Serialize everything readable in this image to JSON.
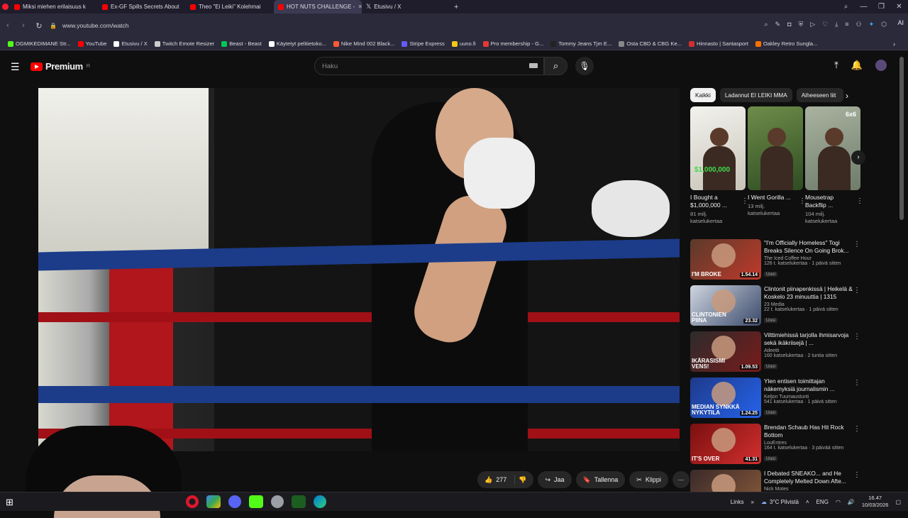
{
  "browser": {
    "tabs": [
      {
        "label": "Miksi miehen erilaisuus k",
        "color": "#ff3b30",
        "active": false
      },
      {
        "label": "Ex-GF Spills Secrets About",
        "color": "#ff0000",
        "active": false
      },
      {
        "label": "Theo \"Ei Leiki\" Kolehmai",
        "color": "#ff0000",
        "active": false
      },
      {
        "label": "HOT NUTS CHALLENGE -",
        "color": "#ff0000",
        "active": true
      },
      {
        "label": "Etusivu / X",
        "color": "#ffffff",
        "active": false
      }
    ],
    "new_tab": "+",
    "url": "www.youtube.com/watch",
    "ai_label": "AI",
    "bookmarks": [
      {
        "label": "OGMIKEDIMANE Str...",
        "color": "#53fc18"
      },
      {
        "label": "YouTube",
        "color": "#ff0000"
      },
      {
        "label": "Etusivu / X",
        "color": "#ffffff"
      },
      {
        "label": "Twitch Emote Resizer",
        "color": "#cccccc"
      },
      {
        "label": "Beast - Beast",
        "color": "#00c853"
      },
      {
        "label": "Käytetyt pelitietoko...",
        "color": "#ffffff"
      },
      {
        "label": "Nike Mind 002 Black...",
        "color": "#ff5a36"
      },
      {
        "label": "Stripe Express",
        "color": "#635bff"
      },
      {
        "label": "uuno.fi",
        "color": "#f5c518"
      },
      {
        "label": "Pro membership - G...",
        "color": "#e53935"
      },
      {
        "label": "Tommy Jeans Tjm E...",
        "color": "#222222"
      },
      {
        "label": "Osta CBD & CBG Ke...",
        "color": "#888888"
      },
      {
        "label": "Hinnasto | Santasport",
        "color": "#d32f2f"
      },
      {
        "label": "Oakley Retro Sungla...",
        "color": "#ff6f00"
      }
    ]
  },
  "youtube": {
    "brand": "Premium",
    "brand_region": "FI",
    "search_placeholder": "Haku",
    "actions": {
      "likes": "277",
      "share": "Jaa",
      "save": "Tallenna",
      "clip": "Klippi"
    },
    "chips": [
      "Kaikki",
      "Ladannut EI LEIKI MMA",
      "Aiheeseen liit"
    ],
    "shorts": [
      {
        "title": "I Bought a $1,000,000 ...",
        "views": "81 milj. katselukertaa",
        "badge": "$1,000,000",
        "c1": "#f2f2ee",
        "c2": "#c9c4b8"
      },
      {
        "title": "I Went Gorilla ...",
        "views": "13 milj. katselukertaa",
        "badge": "",
        "c1": "#6e8d4a",
        "c2": "#2e4d22"
      },
      {
        "title": "Mousetrap Backflip ...",
        "views": "104 milj. katselukertaa",
        "badge": "6x6",
        "c1": "#a9b3a0",
        "c2": "#6f7c6a"
      }
    ],
    "related": [
      {
        "title": "\"I'm Officially Homeless\" Togi Breaks Silence On Going Brok...",
        "channel": "The Iced Coffee Hour",
        "meta": "126 t. katselukertaa · 1 päivä sitten",
        "duration": "1.54.14",
        "tag": "Uusi",
        "c1": "#5a3a2a",
        "c2": "#c0392b",
        "overlay": "I'M BROKE"
      },
      {
        "title": "Clintonit piinapenkissä | Heikelä & Koskelo 23 minuuttia | 1315",
        "channel": "23 Media",
        "meta": "22 t. katselukertaa · 1 päivä sitten",
        "duration": "23.32",
        "tag": "Uusi",
        "c1": "#cfd6e0",
        "c2": "#3b4a6b",
        "overlay": "CLINTONIEN PIINA"
      },
      {
        "title": "Vilttimiehissä tarjolla ihmisarvoja sekä ikäkriisejä | ...",
        "channel": "Atleetti",
        "meta": "160 katselukertaa · 2 tuntia sitten",
        "duration": "1.09.53",
        "tag": "Uusi",
        "c1": "#2c2c2c",
        "c2": "#7a1a1a",
        "overlay": "IKÄRASISMI VENS!"
      },
      {
        "title": "Ylen entisen toimittajan näkemyksiä journalismin ...",
        "channel": "Keljon Tuumaustunti",
        "meta": "541 katselukertaa · 1 päivä sitten",
        "duration": "1.24.25",
        "tag": "Uusi",
        "c1": "#1e3a8a",
        "c2": "#2563eb",
        "overlay": "MEDIAN SYNKKÄ NYKYTILA"
      },
      {
        "title": "Brendan Schaub Has Hit Rock Bottom",
        "channel": "LouEntres",
        "meta": "164 t. katselukertaa · 3 päivää sitten",
        "duration": "41.31",
        "tag": "Uusi",
        "c1": "#7a1010",
        "c2": "#d32f2f",
        "overlay": "IT'S OVER"
      },
      {
        "title": "I Debated SNEAKO... and He Completely Melted Down Afte...",
        "channel": "Nick Motes",
        "meta": "",
        "duration": "",
        "tag": "",
        "c1": "#3a2a2a",
        "c2": "#8a5a3a",
        "overlay": ""
      }
    ]
  },
  "taskbar": {
    "links": "Links",
    "weather": "3°C  Pilvistä",
    "lang": "ENG",
    "time": "16.47",
    "date": "10/03/2026"
  }
}
